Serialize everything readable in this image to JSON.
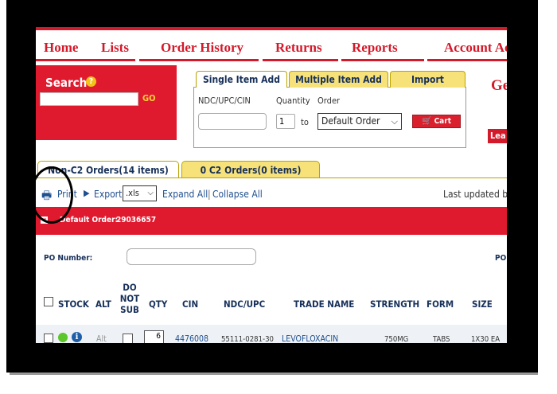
{
  "nav": {
    "items": [
      "Home",
      "Lists",
      "Order History",
      "Returns",
      "Reports",
      "Account Ac"
    ]
  },
  "search": {
    "label": "Search",
    "help_icon": "?",
    "go_label": "GO"
  },
  "item_panel": {
    "tabs": [
      "Single Item Add",
      "Multiple Item Add",
      "Import"
    ],
    "ndc_label": "NDC/UPC/CIN",
    "quantity_label": "Quantity",
    "quantity_value": "1",
    "to_label": "to",
    "order_label": "Order",
    "order_value": "Default Order",
    "cart_label": "Cart"
  },
  "side": {
    "heading": "Ge",
    "button": "Lea"
  },
  "order_tabs": [
    "Non-C2 Orders(14 items)",
    "0 C2 Orders(0 items)"
  ],
  "toolbar": {
    "print": "Print",
    "export": "Export",
    "format": ".xls",
    "expand_all": "Expand All",
    "separator": "|",
    "collapse_all": "Collapse All",
    "last_updated": "Last updated by"
  },
  "order_header": {
    "toggle": "−",
    "label": "Default Order:",
    "number": "29036657"
  },
  "po": {
    "label": "PO Number:",
    "right_label": "PO"
  },
  "columns": [
    "STOCK",
    "ALT",
    "DO NOT SUB",
    "QTY",
    "CIN",
    "NDC/UPC",
    "TRADE NAME",
    "STRENGTH",
    "FORM",
    "SIZE"
  ],
  "row": {
    "alt": "Alt",
    "qty": "6",
    "cin": "4476008",
    "ndc": "55111-0281-30",
    "trade_name": "LEVOFLOXACIN",
    "strength": "750MG",
    "form": "TABS",
    "size": "1X30 EA"
  },
  "colors": {
    "brand_red": "#d4192a",
    "tab_yellow": "#f7e27a",
    "navy_text": "#17305a"
  }
}
